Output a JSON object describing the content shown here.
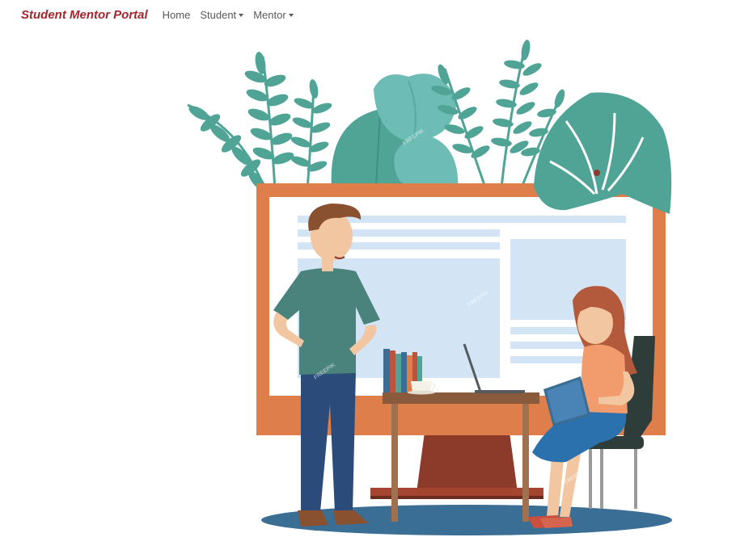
{
  "navbar": {
    "brand": "Student Mentor Portal",
    "items": [
      {
        "label": "Home",
        "dropdown": false
      },
      {
        "label": "Student",
        "dropdown": true
      },
      {
        "label": "Mentor",
        "dropdown": true
      }
    ]
  },
  "hero": {
    "watermark": "FREEPIK"
  },
  "colors": {
    "brand": "#a2272d",
    "nav_text": "#555a5f",
    "monitor_frame": "#dd7e4b",
    "monitor_stand": "#8c3b2b",
    "leaf_teal": "#4fa496",
    "leaf_light": "#6dbcb5",
    "screen_panel": "#d3e4f5",
    "floor_shadow": "#3a6e94"
  }
}
